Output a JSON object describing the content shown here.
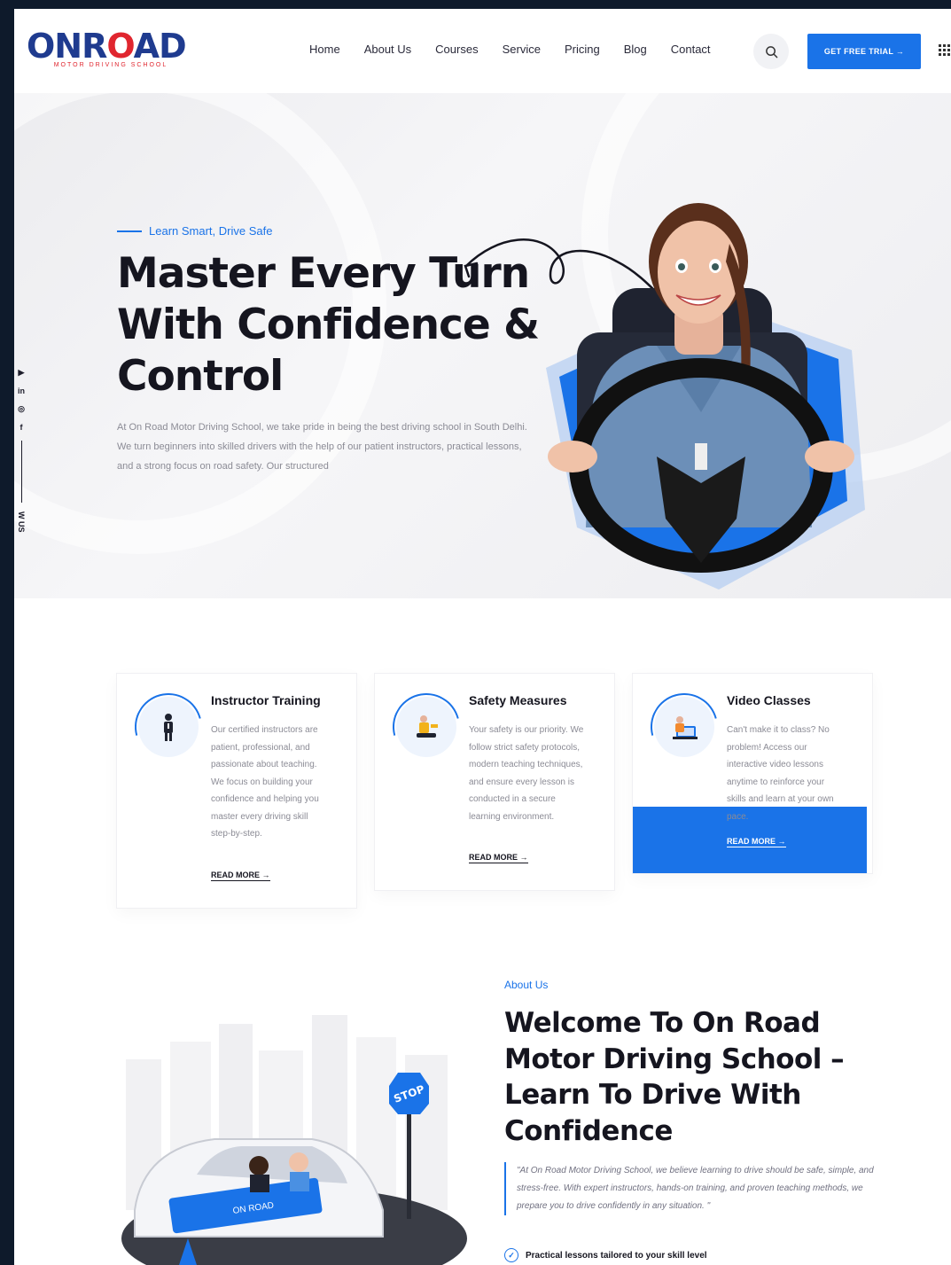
{
  "brand": {
    "logo_left": "ONR",
    "logo_mid": "O",
    "logo_right": "AD",
    "logo_sub": "MOTOR DRIVING SCHOOL"
  },
  "nav": {
    "items": [
      "Home",
      "About Us",
      "Courses",
      "Service",
      "Pricing",
      "Blog",
      "Contact"
    ]
  },
  "header": {
    "cta_label": "GET FREE TRIAL →"
  },
  "hero": {
    "tagline": "Learn Smart, Drive Safe",
    "title_line1": "Master Every Turn",
    "title_line2": "With Confidence &",
    "title_line3": "Control",
    "text": "At On Road Motor Driving School, we take pride in being the best driving school in South Delhi. We turn beginners into skilled drivers with the help of our patient instructors, practical lessons, and a strong focus on road safety. Our structured"
  },
  "social": {
    "follow": "W US",
    "icons": [
      "youtube-icon",
      "linkedin-icon",
      "instagram-icon",
      "facebook-icon"
    ]
  },
  "services": [
    {
      "title": "Instructor Training",
      "text": "Our certified instructors are patient, professional, and passionate about teaching. We focus on building your confidence and helping you master every driving skill step-by-step.",
      "more": "READ MORE →"
    },
    {
      "title": "Safety Measures",
      "text": "Your safety is our priority. We follow strict safety protocols, modern teaching techniques, and ensure every lesson is conducted in a secure learning environment.",
      "more": "READ MORE →"
    },
    {
      "title": "Video Classes",
      "text": "Can't make it to class? No problem! Access our interactive video lessons anytime to reinforce your skills and learn at your own pace.",
      "more": "READ MORE →"
    }
  ],
  "about": {
    "label": "About Us",
    "title": "Welcome To On Road Motor Driving School – Learn To Drive With Confidence",
    "quote": "\"At On Road Motor Driving School, we believe learning to drive should be safe, simple, and stress-free. With expert instructors, hands-on training, and proven teaching methods, we prepare you to drive confidently in any situation. \"",
    "check1": "Practical lessons tailored to your skill level",
    "stop_sign": "STOP",
    "car_text": "ON ROAD"
  },
  "colors": {
    "accent": "#1a73e8",
    "brand_blue": "#1f3b8f",
    "brand_red": "#e0262f",
    "dark": "#15151f"
  }
}
